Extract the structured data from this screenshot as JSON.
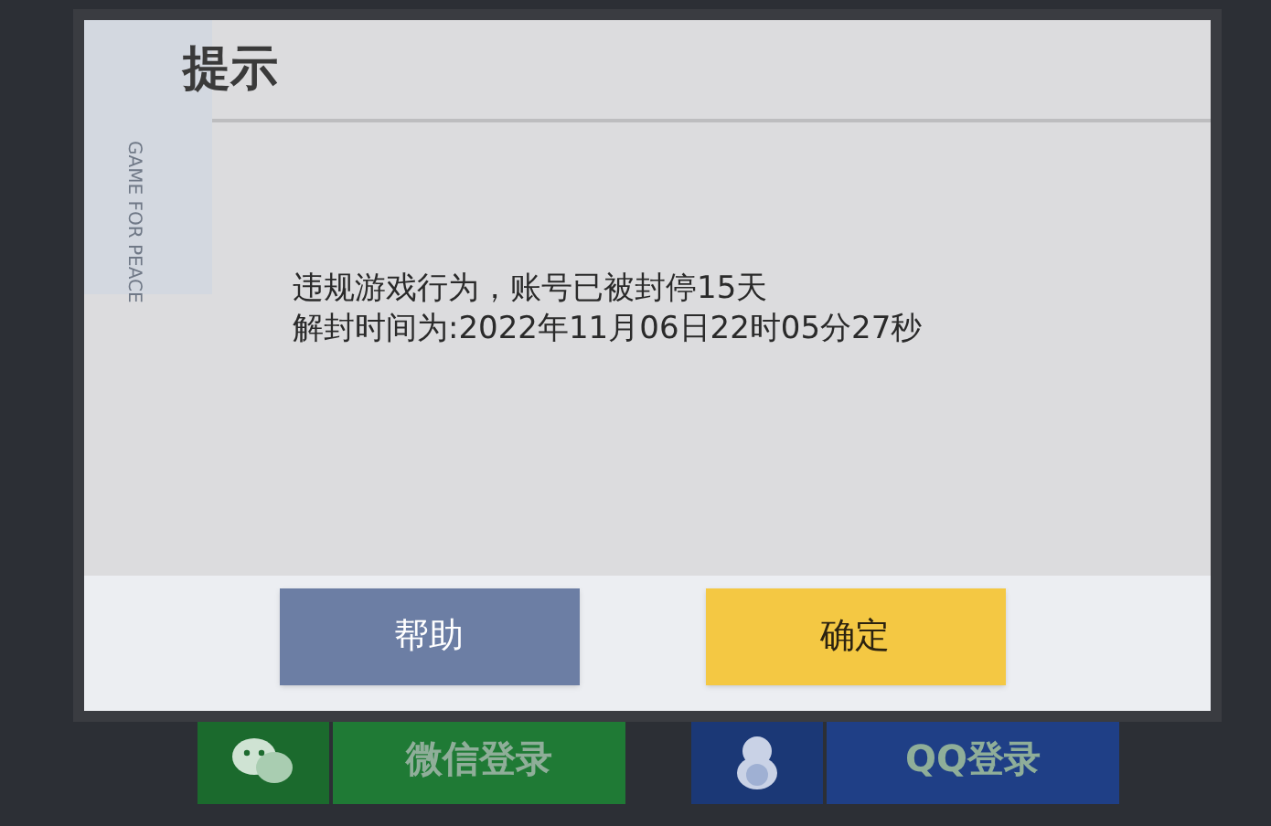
{
  "background": {
    "login_buttons": [
      {
        "kind": "wechat",
        "label": "微信登录"
      },
      {
        "kind": "qq",
        "label": "QQ登录"
      }
    ]
  },
  "dialog": {
    "title": "提示",
    "decoration_text": "GAME FOR PEACE",
    "message_lines": [
      "违规游戏行为，账号已被封停15天",
      "解封时间为:2022年11月06日22时05分27秒"
    ],
    "buttons": [
      {
        "kind": "secondary",
        "label": "帮助"
      },
      {
        "kind": "primary",
        "label": "确定"
      }
    ]
  }
}
